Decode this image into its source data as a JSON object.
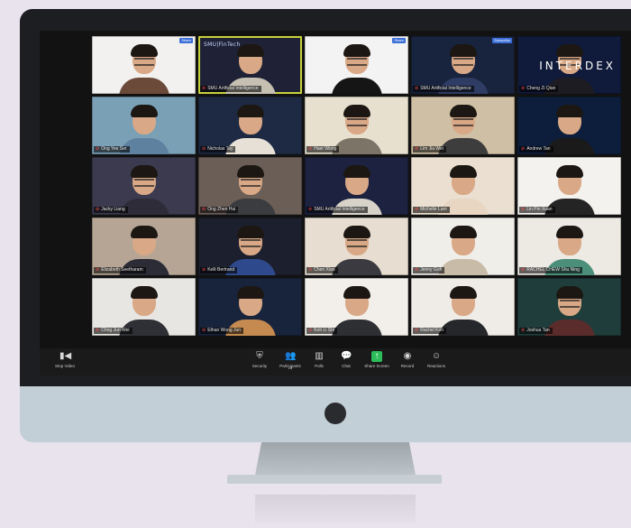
{
  "window": {
    "app": "Zoom",
    "view": "Gallery View"
  },
  "participants": [
    {
      "name": "",
      "bg": "#f2f1ef",
      "shirt": "#6b4a3a",
      "glasses": true,
      "badge": "Share"
    },
    {
      "name": "SMU Artificial Intelligence",
      "bg": "#1f2236",
      "shirt": "#c6c0b2",
      "active": true,
      "logo": "SMU|FinTech"
    },
    {
      "name": "",
      "bg": "#f3f3f4",
      "shirt": "#151515",
      "glasses": true,
      "badge": "Share"
    },
    {
      "name": "SMU Artificial Intelligence",
      "bg": "#18233e",
      "shirt": "#2f3c63",
      "glasses": true,
      "badge": "Subscribe"
    },
    {
      "name": "Cheng Zi Qian",
      "bg": "#101a3a",
      "shirt": "#1c1c22",
      "glasses": true,
      "logo": "INTERDEX"
    },
    {
      "name": "Ong Yee Ser",
      "bg": "#7aa0b6",
      "shirt": "#5e81a0"
    },
    {
      "name": "Nicholas Tay",
      "bg": "#1e2a44",
      "shirt": "#e6e0d6"
    },
    {
      "name": "Haer Wong",
      "bg": "#e7e0cf",
      "shirt": "#7b7467",
      "glasses": true
    },
    {
      "name": "Lim Jia Wei",
      "bg": "#cfbfa4",
      "shirt": "#3d3d3d",
      "glasses": true
    },
    {
      "name": "Andrew Tan",
      "bg": "#0d1e3c",
      "shirt": "#1a1a1a"
    },
    {
      "name": "Jacky Liang",
      "bg": "#3b3a4f",
      "shirt": "#2e2c38",
      "glasses": true
    },
    {
      "name": "Ong Zhen Hui",
      "bg": "#6b5e57",
      "shirt": "#3b3c40",
      "glasses": true
    },
    {
      "name": "SMU Artificial Intelligence",
      "bg": "#1c2240",
      "shirt": "#d8d3c9"
    },
    {
      "name": "Michelle Lam",
      "bg": "#eadfd0",
      "shirt": "#e8d6c2"
    },
    {
      "name": "Lin Pin Xuan",
      "bg": "#f4f2ee",
      "shirt": "#242424"
    },
    {
      "name": "Elizabeth Seetharam",
      "bg": "#b6a594",
      "shirt": "#2b2c35"
    },
    {
      "name": "Kelli Bertrand",
      "bg": "#1c1f2d",
      "shirt": "#2e4a8c",
      "glasses": true
    },
    {
      "name": "Chen Xiao",
      "bg": "#e7ddd0",
      "shirt": "#3a3a40",
      "glasses": true
    },
    {
      "name": "Jenny Goh",
      "bg": "#f0eee9",
      "shirt": "#c8bba8"
    },
    {
      "name": "RACHEL CHEW Shu Ning",
      "bg": "#ede9e3",
      "shirt": "#4b8f7a"
    },
    {
      "name": "Chng Jun Wei",
      "bg": "#e8e6e2",
      "shirt": "#2f3035"
    },
    {
      "name": "Ethan Wong Jun",
      "bg": "#18243c",
      "shirt": "#c48a4f"
    },
    {
      "name": "Koh Li Shi",
      "bg": "#f2efea",
      "shirt": "#2e2f33"
    },
    {
      "name": "Rachel Koh",
      "bg": "#efebe6",
      "shirt": "#26272b"
    },
    {
      "name": "Joshua Tan",
      "bg": "#1f3d3a",
      "shirt": "#5b2c2c",
      "glasses": true
    }
  ],
  "toolbar": {
    "stop_video": "Stop Video",
    "security": "Security",
    "participants": "Participants",
    "participants_count": "25",
    "polls": "Polls",
    "chat": "Chat",
    "share_screen": "Share Screen",
    "record": "Record",
    "reactions": "Reactions"
  },
  "colors": {
    "page_bg": "#e9e3ee",
    "monitor_body": "#c3cfd6",
    "bezel": "#1d1e22",
    "active_speaker": "#c8d23a",
    "share_green": "#2dbd5a",
    "muted_red": "#ff4d4d"
  }
}
